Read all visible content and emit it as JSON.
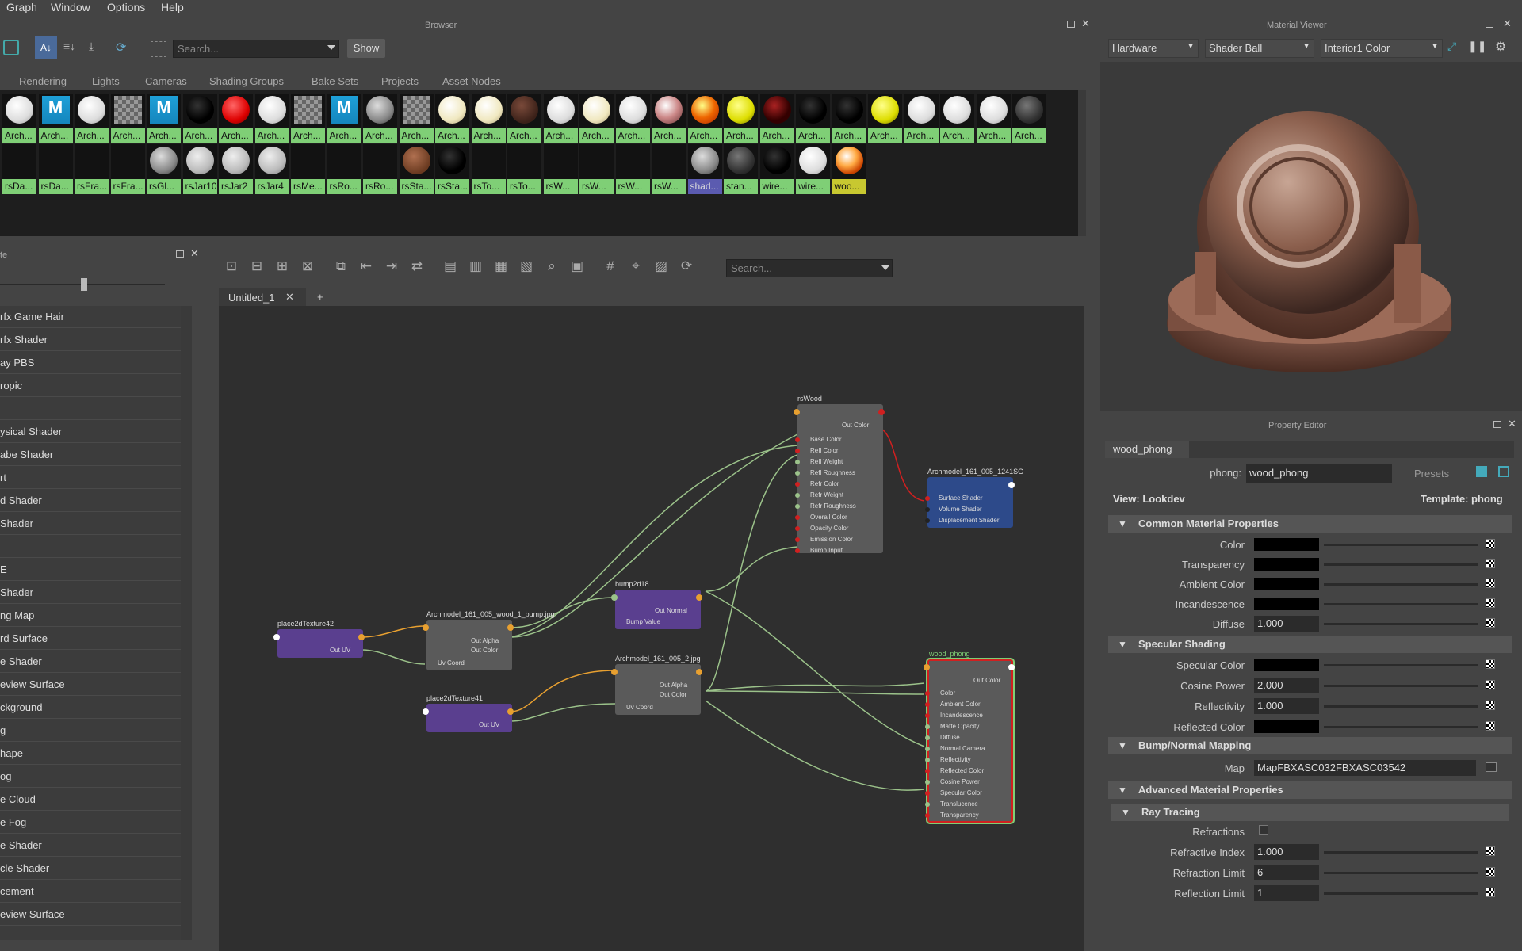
{
  "menu": [
    "Graph",
    "Window",
    "Options",
    "Help"
  ],
  "browser": {
    "title": "Browser",
    "search_placeholder": "Search...",
    "show_label": "Show",
    "tabs": [
      "Rendering",
      "Lights",
      "Cameras",
      "Shading Groups",
      "Bake Sets",
      "Projects",
      "Asset Nodes"
    ],
    "row1": [
      {
        "label": "Arch...",
        "ball": "white"
      },
      {
        "label": "Arch...",
        "ball": "maya"
      },
      {
        "label": "Arch...",
        "ball": "white"
      },
      {
        "label": "Arch...",
        "ball": "checker"
      },
      {
        "label": "Arch...",
        "ball": "maya"
      },
      {
        "label": "Arch...",
        "ball": "black"
      },
      {
        "label": "Arch...",
        "ball": "red"
      },
      {
        "label": "Arch...",
        "ball": "white"
      },
      {
        "label": "Arch...",
        "ball": "checker"
      },
      {
        "label": "Arch...",
        "ball": "maya"
      },
      {
        "label": "Arch...",
        "ball": "grey"
      },
      {
        "label": "Arch...",
        "ball": "checker"
      },
      {
        "label": "Arch...",
        "ball": "cream"
      },
      {
        "label": "Arch...",
        "ball": "cream"
      },
      {
        "label": "Arch...",
        "ball": "rust"
      },
      {
        "label": "Arch...",
        "ball": "white"
      },
      {
        "label": "Arch...",
        "ball": "cream"
      },
      {
        "label": "Arch...",
        "ball": "white"
      },
      {
        "label": "Arch...",
        "ball": "mixed"
      },
      {
        "label": "Arch...",
        "ball": "fire"
      },
      {
        "label": "Arch...",
        "ball": "yellow"
      },
      {
        "label": "Arch...",
        "ball": "dark-red"
      },
      {
        "label": "Arch...",
        "ball": "black"
      },
      {
        "label": "Arch...",
        "ball": "black"
      },
      {
        "label": "Arch...",
        "ball": "yellow"
      },
      {
        "label": "Arch...",
        "ball": "white"
      },
      {
        "label": "Arch...",
        "ball": "white"
      },
      {
        "label": "Arch...",
        "ball": "white"
      },
      {
        "label": "Arch...",
        "ball": "dark-grey"
      }
    ],
    "row2": [
      {
        "label": "rsDa...",
        "ball": "none"
      },
      {
        "label": "rsDa...",
        "ball": "none"
      },
      {
        "label": "rsFra...",
        "ball": "none"
      },
      {
        "label": "rsFra...",
        "ball": "none"
      },
      {
        "label": "rsGl...",
        "ball": "grey"
      },
      {
        "label": "rsJar10",
        "ball": "light-grey"
      },
      {
        "label": "rsJar2",
        "ball": "light-grey"
      },
      {
        "label": "rsJar4",
        "ball": "light-grey"
      },
      {
        "label": "rsMe...",
        "ball": "none"
      },
      {
        "label": "rsRo...",
        "ball": "none"
      },
      {
        "label": "rsRo...",
        "ball": "none"
      },
      {
        "label": "rsSta...",
        "ball": "brown"
      },
      {
        "label": "rsSta...",
        "ball": "black"
      },
      {
        "label": "rsTo...",
        "ball": "none"
      },
      {
        "label": "rsTo...",
        "ball": "none"
      },
      {
        "label": "rsW...",
        "ball": "none"
      },
      {
        "label": "rsW...",
        "ball": "none"
      },
      {
        "label": "rsW...",
        "ball": "none"
      },
      {
        "label": "rsW...",
        "ball": "none"
      },
      {
        "label": "shad...",
        "ball": "grey"
      },
      {
        "label": "stan...",
        "ball": "dark-grey"
      },
      {
        "label": "wire...",
        "ball": "black"
      },
      {
        "label": "wire...",
        "ball": "white"
      },
      {
        "label": "woo...",
        "ball": "wood"
      }
    ]
  },
  "left": {
    "title": "te",
    "items": [
      "rfx Game Hair",
      "rfx Shader",
      "ay PBS",
      "ropic",
      "",
      "ysical Shader",
      "abe Shader",
      "rt",
      "d Shader",
      "Shader",
      "",
      "E",
      "Shader",
      "ng Map",
      "rd Surface",
      "e Shader",
      "eview Surface",
      "ckground",
      "g",
      "hape",
      "og",
      "e Cloud",
      "e Fog",
      "e Shader",
      "cle Shader",
      "cement",
      "eview Surface"
    ]
  },
  "graph": {
    "tab_label": "Untitled_1",
    "add_tab": "+",
    "search_placeholder": "Search...",
    "nodes": {
      "rswood": {
        "title": "rsWood",
        "out": "Out Color",
        "ports": [
          "Base Color",
          "Refl Color",
          "Refl Weight",
          "Refl Roughness",
          "Refr Color",
          "Refr Weight",
          "Refr Roughness",
          "Overall Color",
          "Opacity Color",
          "Emission Color",
          "Bump Input"
        ]
      },
      "sg": {
        "title": "Archmodel_161_005_1241SG",
        "ports": [
          "Surface Shader",
          "Volume Shader",
          "Displacement Shader"
        ]
      },
      "bump": {
        "title": "bump2d18",
        "out": "Out Normal",
        "ports": [
          "Bump Value"
        ]
      },
      "place42": {
        "title": "place2dTexture42",
        "out": "Out UV"
      },
      "bumpfile": {
        "title": "Archmodel_161_005_wood_1_bump.jpg",
        "outs": [
          "Out Alpha",
          "Out Color"
        ],
        "ports": [
          "Uv Coord"
        ]
      },
      "file2": {
        "title": "Archmodel_161_005_2.jpg",
        "outs": [
          "Out Alpha",
          "Out Color"
        ],
        "ports": [
          "Uv Coord"
        ]
      },
      "place41": {
        "title": "place2dTexture41",
        "out": "Out UV"
      },
      "phong": {
        "title": "wood_phong",
        "out": "Out Color",
        "ports": [
          "Color",
          "Ambient Color",
          "Incandescence",
          "Matte Opacity",
          "Diffuse",
          "Normal Camera",
          "Reflectivity",
          "Reflected Color",
          "Cosine Power",
          "Specular Color",
          "Translucence",
          "Transparency"
        ]
      }
    }
  },
  "viewer": {
    "title": "Material Viewer",
    "renderer": "Hardware",
    "shape": "Shader Ball",
    "env": "Interior1 Color"
  },
  "property_editor": {
    "title": "Property Editor",
    "tab": "wood_phong",
    "type_label": "phong:",
    "name_value": "wood_phong",
    "presets": "Presets",
    "view_label": "View: Lookdev",
    "template_label": "Template: phong",
    "sections": {
      "common": "Common Material Properties",
      "specular": "Specular Shading",
      "bump": "Bump/Normal Mapping",
      "advanced": "Advanced Material Properties",
      "ray": "Ray Tracing"
    },
    "common": [
      {
        "label": "Color"
      },
      {
        "label": "Transparency"
      },
      {
        "label": "Ambient Color"
      },
      {
        "label": "Incandescence"
      },
      {
        "label": "Diffuse",
        "value": "1.000"
      }
    ],
    "specular": [
      {
        "label": "Specular Color"
      },
      {
        "label": "Cosine Power",
        "value": "2.000"
      },
      {
        "label": "Reflectivity",
        "value": "1.000"
      },
      {
        "label": "Reflected Color"
      }
    ],
    "map_label": "Map",
    "map_value": "MapFBXASC032FBXASC03542",
    "ray": [
      {
        "label": "Refractions"
      },
      {
        "label": "Refractive Index",
        "value": "1.000"
      },
      {
        "label": "Refraction Limit",
        "value": "6"
      },
      {
        "label": "Reflection Limit",
        "value": "1"
      }
    ]
  }
}
